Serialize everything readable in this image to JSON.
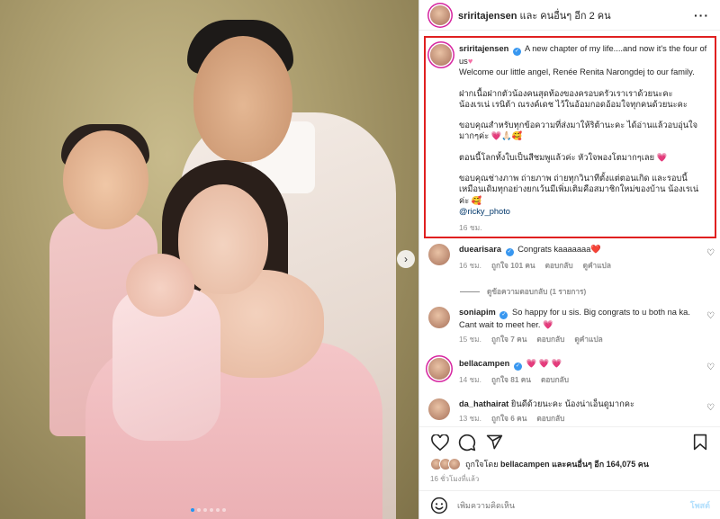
{
  "header": {
    "username": "sriritajensen",
    "suffix": "และ คนอื่นๆ อีก 2 คน",
    "more_icon": "more-icon"
  },
  "photo": {
    "carousel_dots": 6,
    "active_dot": 0
  },
  "caption": {
    "username": "sriritajensen",
    "line1": "A new chapter of my life....and now it's the four of us",
    "line2": "Welcome our little angel, Renée Renita Narongdej to our family.",
    "para2a": "ฝากเนื้อฝากตัวน้องคนสุดท้องของครอบครัวเราเราด้วยนะคะ",
    "para2b": "น้องเรเน่ เรนิต้า ณรงค์เดช ไว้ในอ้อมกอดอ้อมใจทุกคนด้วยนะคะ",
    "para3": "ขอบคุณสำหรับทุกข้อความที่ส่งมาให้ริต้านะคะ ได้อ่านแล้วอบอุ่นใจมากๆค่ะ 💗🙏🏻🥰",
    "para4": "ตอนนี้โลกทั้งใบเป็นสีชมพูแล้วค่ะ หัวใจพองโตมากๆเลย 💗",
    "para5": "ขอบคุณช่างภาพ ถ่ายภาพ ถ่ายทุกวินาทีตั้งแต่ตอนเกิด และรอบนี้เหมือนเดิมทุกอย่างยกเว้นมีเพิ่มเติมคือสมาชิกใหม่ของบ้าน น้องเรเน่ ค่ะ 🥰",
    "mention": "@ricky_photo",
    "time": "16 ชม."
  },
  "comments": [
    {
      "username": "duearisara",
      "verified": true,
      "text": "Congrats kaaaaaaa❤️",
      "time": "16 ชม.",
      "likes": "ถูกใจ 101 คน",
      "reply": "ตอบกลับ",
      "translate": "ดูคำแปล"
    },
    {
      "username": "soniapim",
      "verified": true,
      "text": "So happy for u sis. Big congrats to u both na ka. Cant wait to meet her. 💗",
      "time": "15 ชม.",
      "likes": "ถูกใจ 7 คน",
      "reply": "ตอบกลับ",
      "translate": "ดูคำแปล"
    },
    {
      "username": "bellacampen",
      "verified": true,
      "text": "💗 💗 💗",
      "time": "14 ชม.",
      "likes": "ถูกใจ 81 คน",
      "reply": "ตอบกลับ"
    },
    {
      "username": "da_hathairat",
      "verified": false,
      "text": "ยินดีด้วยนะคะ น้องน่าเอ็นดูมากคะ",
      "time": "13 ชม.",
      "likes": "ถูกใจ 6 คน",
      "reply": "ตอบกลับ"
    }
  ],
  "view_replies": "ดูข้อความตอบกลับ (1 รายการ)",
  "likes_line": {
    "prefix": "ถูกใจโดย",
    "user": "bellacampen",
    "rest": "และคนอื่นๆ อีก 164,075 คน"
  },
  "post_time": "16 ชั่วโมงที่แล้ว",
  "comment_input": {
    "placeholder": "เพิ่มความคิดเห็น",
    "post_label": "โพสต์"
  },
  "colors": {
    "highlight_border": "#e02020",
    "verified": "#3897f0",
    "link": "#00376b"
  }
}
